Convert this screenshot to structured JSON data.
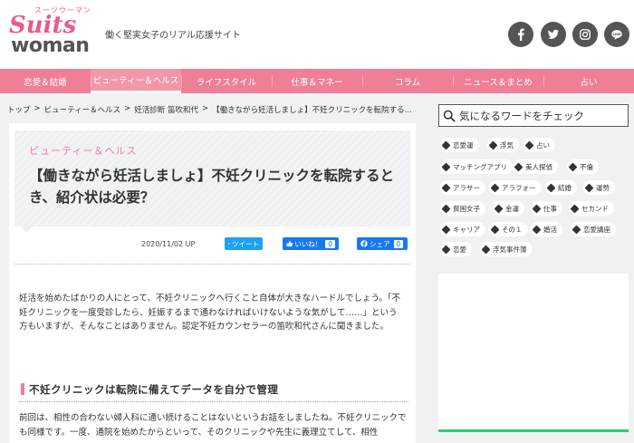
{
  "header": {
    "logo_kana": "スーツウーマン",
    "logo_top": "Suits",
    "logo_bottom": "woman",
    "tagline": "働く堅実女子のリアル応援サイト",
    "social": [
      {
        "name": "facebook-icon"
      },
      {
        "name": "twitter-icon"
      },
      {
        "name": "instagram-icon"
      },
      {
        "name": "line-icon",
        "label": "LINE"
      }
    ]
  },
  "nav": {
    "items": [
      {
        "label": "恋愛＆結婚"
      },
      {
        "label": "ビューティー＆ヘルス"
      },
      {
        "label": "ライフスタイル"
      },
      {
        "label": "仕事＆マネー"
      },
      {
        "label": "コラム"
      },
      {
        "label": "ニュース＆まとめ"
      },
      {
        "label": "占い"
      }
    ],
    "active_index": 1
  },
  "breadcrumb": {
    "items": [
      "トップ",
      "ビューティー＆ヘルス",
      "妊活診断 笛吹和代",
      "【働きながら妊活しましょ】不妊クリニックを転院する..."
    ],
    "separator": ">"
  },
  "article": {
    "category": "ビューティー＆ヘルス",
    "title": "【働きながら妊活しましょ】不妊クリニックを転院するとき、紹介状は必要？",
    "date": "2020/11/02 UP",
    "share": {
      "tweet_label": "ツイート",
      "like_label": "いいね！",
      "like_count": "0",
      "share_label": "シェア",
      "share_count": "0"
    },
    "lead": "妊活を始めたばかりの人にとって、不妊クリニックへ行くこと自体が大きなハードルでしょう。「不妊クリニックを一度受診したら、妊娠するまで通わなければいけないような気がして……」という方もいますが、そんなことはありません。認定不妊カウンセラーの笛吹和代さんに聞きました。",
    "section_title": "不妊クリニックは転院に備えてデータを自分で管理",
    "body": "前回は、相性の合わない婦人科に通い続けることはないというお話をしましたね。不妊クリニックでも同様です。一度、通院を始めたからといって、そのクリニックや先生に義理立てして、相性"
  },
  "sidebar": {
    "search_placeholder": "気になるワードをチェック",
    "tags": [
      "恋愛運",
      "浮気",
      "占い",
      "マッチングアプリ",
      "美人探偵",
      "不倫",
      "アラサー",
      "アラフォー",
      "結婚",
      "運勢",
      "貧困女子",
      "金運",
      "仕事",
      "セカンド",
      "キャリア",
      "その１",
      "婚活",
      "恋愛講座",
      "恋愛",
      "浮気事件簿"
    ]
  }
}
